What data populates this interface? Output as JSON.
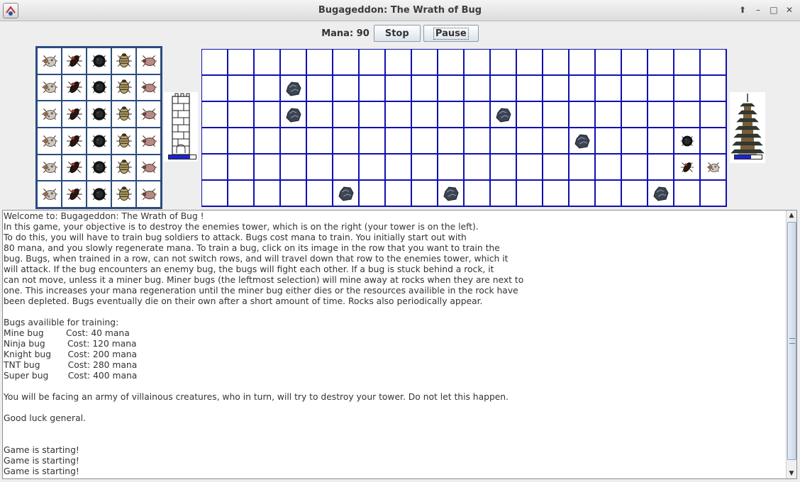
{
  "window": {
    "title": "Bugageddon: The Wrath of Bug"
  },
  "toolbar": {
    "mana_label": "Mana: 90",
    "stop_label": "Stop",
    "pause_label": "Pause"
  },
  "bug_picker": {
    "rows": 6,
    "columns": [
      "mine-bug-icon",
      "ninja-bug-icon",
      "knight-bug-icon",
      "tnt-bug-icon",
      "super-bug-icon"
    ]
  },
  "player_tower": {
    "icon": "tower-icon",
    "health": 0.8,
    "health_color": "#1b22d8"
  },
  "enemy_tower": {
    "icon": "pagoda-icon",
    "health": 0.6,
    "health_color": "#1b22d8"
  },
  "battlefield": {
    "rows": 6,
    "columns": 20,
    "grid_color": "#1010b0",
    "entities": [
      {
        "type": "rock",
        "row": 1,
        "col": 3
      },
      {
        "type": "rock",
        "row": 2,
        "col": 3
      },
      {
        "type": "rock",
        "row": 2,
        "col": 11
      },
      {
        "type": "rock",
        "row": 3,
        "col": 14
      },
      {
        "type": "enemy-blob-bug",
        "row": 3,
        "col": 18
      },
      {
        "type": "ninja-bug",
        "row": 4,
        "col": 18
      },
      {
        "type": "mine-bug",
        "row": 4,
        "col": 19
      },
      {
        "type": "rock",
        "row": 5,
        "col": 5
      },
      {
        "type": "rock",
        "row": 5,
        "col": 9
      },
      {
        "type": "rock",
        "row": 5,
        "col": 17
      }
    ]
  },
  "log": {
    "text": "Welcome to: Bugageddon: The Wrath of Bug !\nIn this game, your objective is to destroy the enemies tower, which is on the right (your tower is on the left).\nTo do this, you will have to train bug soldiers to attack. Bugs cost mana to train. You initially start out with\n80 mana, and you slowly regenerate mana. To train a bug, click on its image in the row that you want to train the\nbug. Bugs, when trained in a row, can not switch rows, and will travel down that row to the enemies tower, which it\nwill attack. If the bug encounters an enemy bug, the bugs will fight each other. If a bug is stuck behind a rock, it\ncan not move, unless it a miner bug. Miner bugs (the leftmost selection) will mine away at rocks when they are next to\none. This increases your mana regeneration until the miner bug either dies or the resources availible in the rock have\nbeen depleted. Bugs eventually die on their own after a short amount of time. Rocks also periodically appear.\n\nBugs availible for training:\nMine bug        Cost: 40 mana\nNinja bug        Cost: 120 mana\nKnight bug      Cost: 200 mana\nTNT bug          Cost: 280 mana\nSuper bug       Cost: 400 mana\n\nYou will be facing an army of villainous creatures, who in turn, will try to destroy your tower. Do not let this happen.\n\nGood luck general.\n\n\nGame is starting!\nGame is starting!\nGame is starting!"
  }
}
